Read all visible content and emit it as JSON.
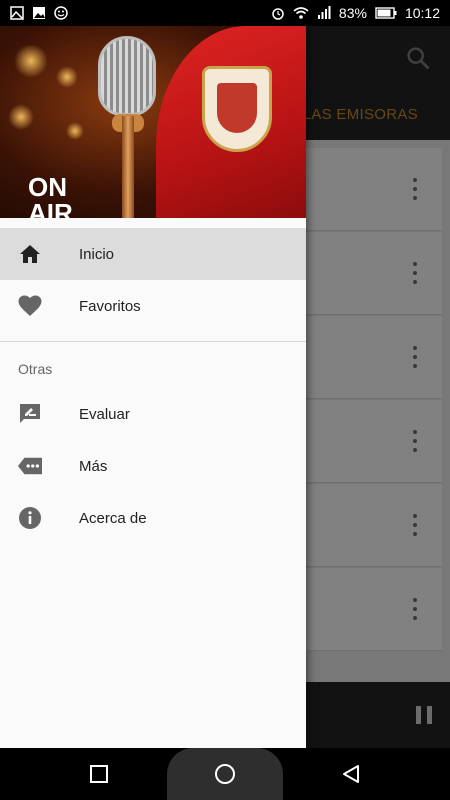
{
  "status_bar": {
    "battery_text": "83%",
    "time": "10:12",
    "left_icons": [
      "image-icon",
      "gallery-icon",
      "smiley-icon"
    ],
    "right_icons": [
      "alarm-icon",
      "wifi-icon",
      "signal-icon",
      "battery-icon"
    ]
  },
  "app": {
    "tab_label": "LAS EMISORAS",
    "list_rows": 6,
    "accent_color": "#c58a2b"
  },
  "drawer": {
    "header": {
      "on_text": "ON",
      "air_text": "AIR"
    },
    "items": [
      {
        "label": "Inicio",
        "icon": "home-icon",
        "active": true
      },
      {
        "label": "Favoritos",
        "icon": "heart-icon",
        "active": false
      }
    ],
    "section_title": "Otras",
    "other_items": [
      {
        "label": "Evaluar",
        "icon": "rate-review-icon"
      },
      {
        "label": "Más",
        "icon": "more-icon"
      },
      {
        "label": "Acerca de",
        "icon": "info-icon"
      }
    ]
  },
  "nav_bar": {
    "buttons": [
      "recents-button",
      "home-button",
      "back-button"
    ]
  }
}
